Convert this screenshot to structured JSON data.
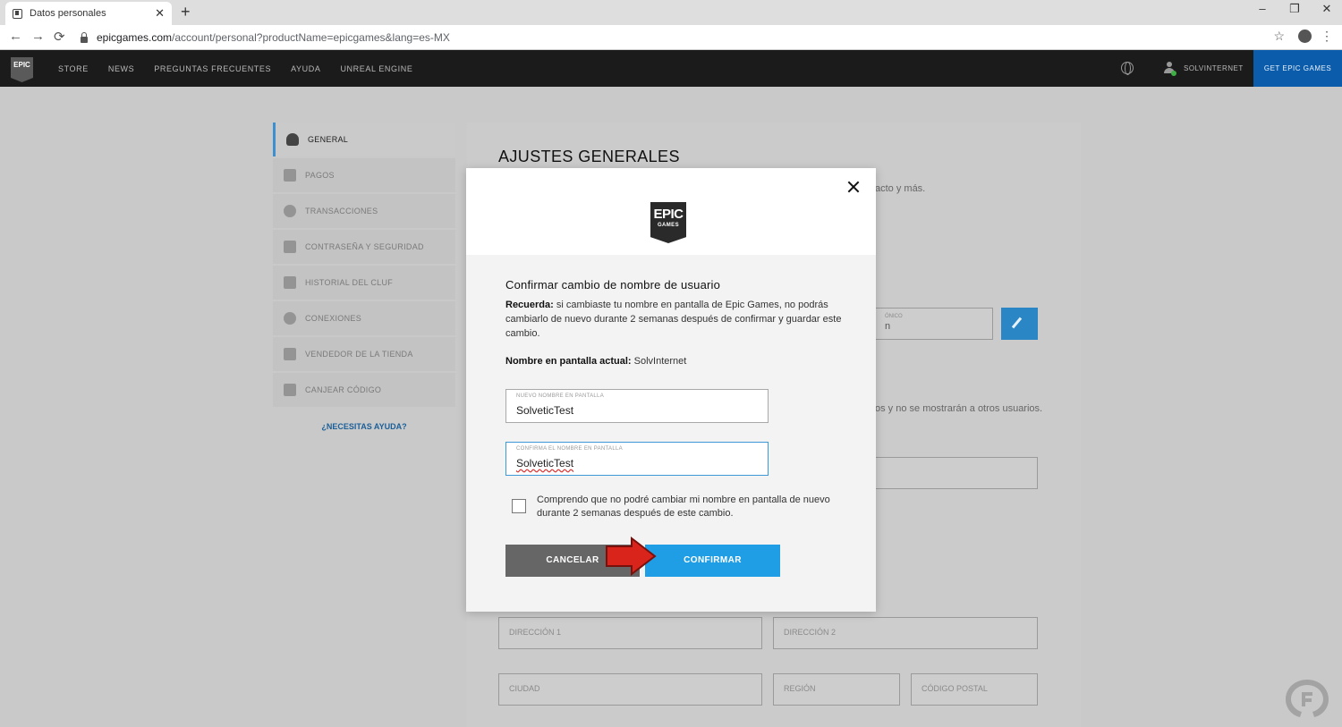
{
  "browser": {
    "tab_title": "Datos personales",
    "tab_close": "✕",
    "new_tab": "+",
    "win_minimize": "–",
    "win_restore": "❐",
    "win_close": "✕",
    "back": "←",
    "forward": "→",
    "reload": "⟳",
    "url_host": "epicgames.com",
    "url_path": "/account/personal?productName=epicgames&lang=es-MX",
    "star": "☆",
    "menu": "⋮"
  },
  "nav": {
    "logo": "EPIC",
    "links": [
      "STORE",
      "NEWS",
      "PREGUNTAS FRECUENTES",
      "AYUDA",
      "UNREAL ENGINE"
    ],
    "username": "SOLVINTERNET",
    "get_epic": "GET EPIC GAMES"
  },
  "sidebar": {
    "items": [
      {
        "label": "GENERAL",
        "icon": "user-icon"
      },
      {
        "label": "PAGOS",
        "icon": "payment-icon"
      },
      {
        "label": "TRANSACCIONES",
        "icon": "history-icon"
      },
      {
        "label": "CONTRASEÑA Y SEGURIDAD",
        "icon": "key-icon"
      },
      {
        "label": "HISTORIAL DEL CLUF",
        "icon": "clipboard-icon"
      },
      {
        "label": "CONEXIONES",
        "icon": "share-icon"
      },
      {
        "label": "VENDEDOR DE LA TIENDA",
        "icon": "store-icon"
      },
      {
        "label": "CANJEAR CÓDIGO",
        "icon": "gift-icon"
      }
    ],
    "help": "¿NECESITAS AYUDA?"
  },
  "page": {
    "title": "AJUSTES GENERALES",
    "fragment_contact": "acto y más.",
    "fragment_field_label": "ÓNICO",
    "fragment_field_value": "n",
    "fragment_privacy": "os y no se mostrarán a otros usuarios.",
    "address1": "DIRECCIÓN 1",
    "address2": "DIRECCIÓN 2",
    "city": "CIUDAD",
    "region": "REGIÓN",
    "postal": "CÓDIGO POSTAL"
  },
  "modal": {
    "logo_line1": "EPIC",
    "logo_line2": "GAMES",
    "title": "Confirmar cambio de nombre de usuario",
    "reminder_label": "Recuerda:",
    "reminder_text": " si cambiaste tu nombre en pantalla de Epic Games, no podrás cambiarlo de nuevo durante 2 semanas después de confirmar y guardar este cambio.",
    "current_label": "Nombre en pantalla actual:",
    "current_value": " SolvInternet",
    "new_name_label": "NUEVO NOMBRE EN PANTALLA",
    "new_name_value": "SolveticTest",
    "confirm_name_label": "CONFIRMA EL NOMBRE EN PANTALLA",
    "confirm_name_value": "SolveticTest",
    "checkbox_text": "Comprendo que no podré cambiar mi nombre en pantalla de nuevo durante 2 semanas después de este cambio.",
    "cancel": "CANCELAR",
    "confirm": "CONFIRMAR"
  },
  "colors": {
    "accent": "#1f9ee6",
    "nav_bg": "#1b1b1b",
    "get_epic_bg": "#0b5cab",
    "arrow": "#d9241c"
  }
}
